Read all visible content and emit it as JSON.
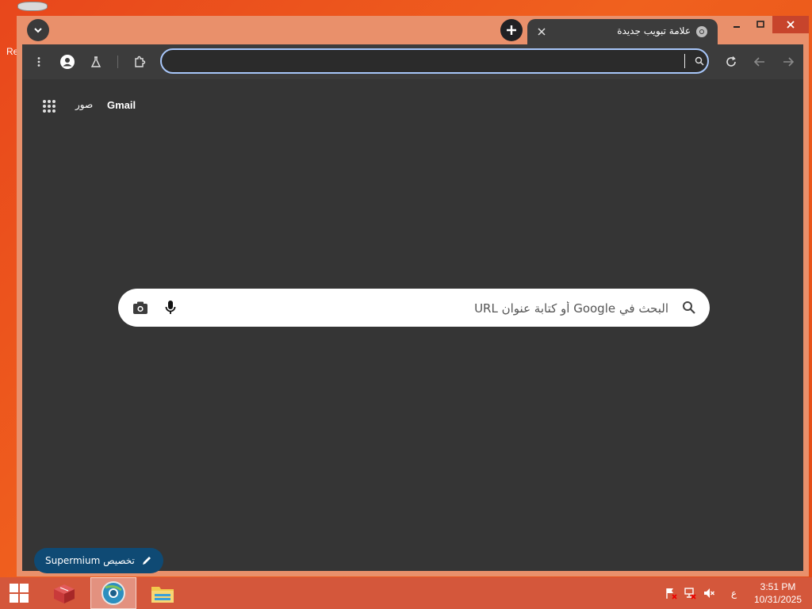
{
  "desktop": {
    "icon_label": "Re"
  },
  "browser": {
    "tab": {
      "title": "علامة تبويب جديدة"
    },
    "omnibox": {
      "value": ""
    },
    "ntp": {
      "gmail_label": "Gmail",
      "images_label": "صور",
      "search_placeholder": "البحث في Google أو كتابة عنوان URL",
      "customize_label": "تخصيص Supermium"
    }
  },
  "taskbar": {
    "language": "ع",
    "time": "3:51 PM",
    "date": "10/31/2025"
  },
  "colors": {
    "accent": "#a8c7fa",
    "window_frame": "#e9906b",
    "customize_button": "#0f4a74",
    "content_bg": "#353535"
  }
}
